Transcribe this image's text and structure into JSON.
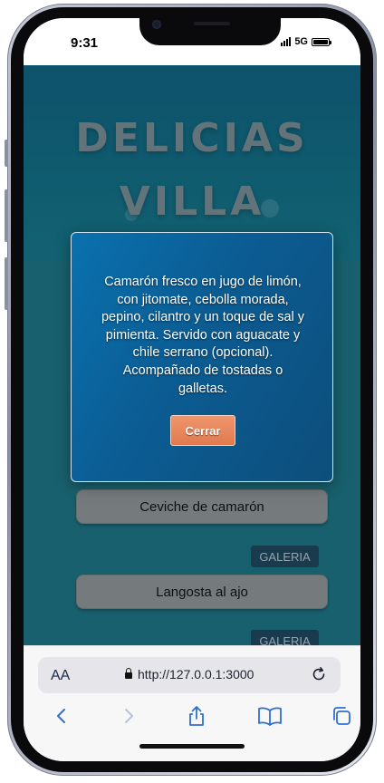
{
  "status_bar": {
    "time": "9:31",
    "network": "5G"
  },
  "site": {
    "title_line1": "DELICIAS",
    "title_line2": "VILLA"
  },
  "dishes": [
    {
      "name": "Ceviche de camarón",
      "gallery_label": "GALERIA"
    },
    {
      "name": "Langosta al ajo",
      "gallery_label": "GALERIA"
    }
  ],
  "modal": {
    "description": "Camarón fresco en jugo de limón, con jitomate, cebolla morada, pepino, cilantro y un toque de sal y pimienta. Servido con aguacate y chile serrano (opcional). Acompañado de tostadas o galletas.",
    "close_label": "Cerrar"
  },
  "browser": {
    "text_size_label": "AA",
    "url": "http://127.0.0.1:3000",
    "icons": [
      "lock-icon",
      "reload-icon",
      "back-icon",
      "forward-icon",
      "share-icon",
      "bookmarks-icon",
      "tabs-icon"
    ]
  },
  "colors": {
    "page_bg": "#17606e",
    "modal_bg": "#0b5c93",
    "close_button": "#e07a4f",
    "browser_accent": "#2f6fd1"
  }
}
